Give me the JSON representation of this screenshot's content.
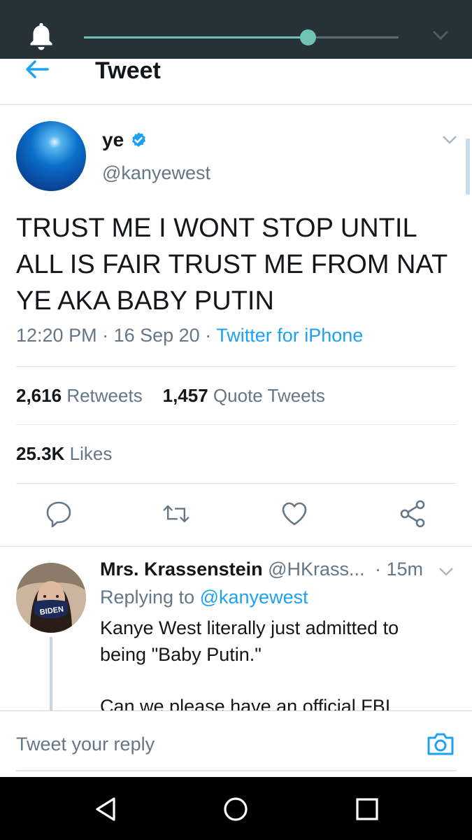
{
  "status": {
    "icons": [
      "bell-icon",
      "chevron-down-icon"
    ],
    "brightness_level": 0.71,
    "accent_color": "#6fc2b4"
  },
  "header": {
    "title": "Tweet",
    "back_icon": "arrow-left-icon"
  },
  "tweet": {
    "author": {
      "name": "ye",
      "handle": "@kanyewest",
      "verified": true
    },
    "text": "TRUST ME I WONT STOP UNTIL ALL IS FAIR TRUST ME FROM NAT YE AKA BABY PUTIN",
    "time": "12:20 PM",
    "date": "16 Sep 20",
    "source": "Twitter for iPhone",
    "retweets_count": "2,616",
    "retweets_label": "Retweets",
    "quotes_count": "1,457",
    "quotes_label": "Quote Tweets",
    "likes_count": "25.3K",
    "likes_label": "Likes",
    "actions": [
      "reply-icon",
      "retweet-icon",
      "like-icon",
      "share-icon"
    ]
  },
  "reply": {
    "name": "Mrs. Krassenstein",
    "handle": "@HKrass...",
    "time": "· 15m",
    "replying_prefix": "Replying to",
    "replying_to": "@kanyewest",
    "text_line1": "Kanye West literally just admitted to being \"Baby Putin.\"",
    "text_line2": "Can we please have an official FBI",
    "mask_text": "BIDEN"
  },
  "compose": {
    "placeholder": "Tweet your reply",
    "camera_icon": "camera-icon"
  },
  "navbar": {
    "icons": [
      "back-triangle-icon",
      "home-circle-icon",
      "recents-square-icon"
    ]
  },
  "colors": {
    "brand_blue": "#1da1f2",
    "text_primary": "#14171a",
    "text_secondary": "#657786"
  }
}
